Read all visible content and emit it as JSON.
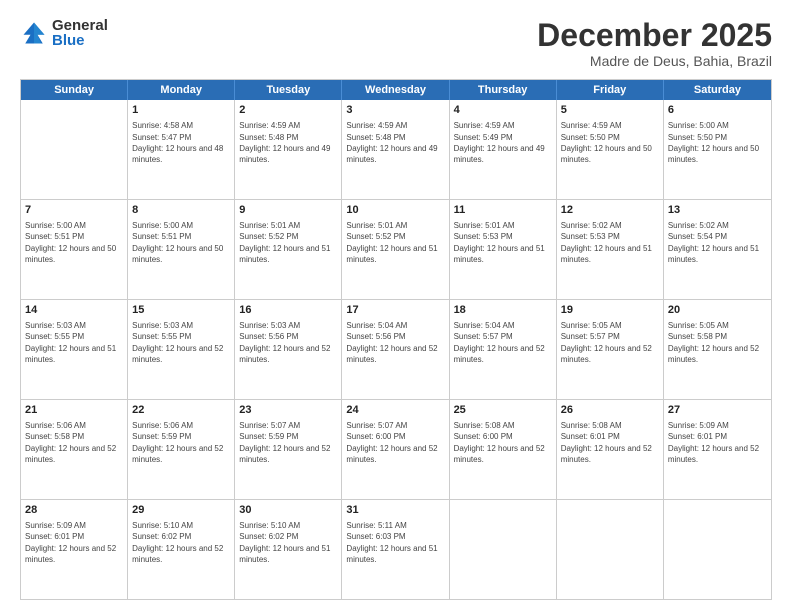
{
  "logo": {
    "general": "General",
    "blue": "Blue"
  },
  "header": {
    "month": "December 2025",
    "location": "Madre de Deus, Bahia, Brazil"
  },
  "weekdays": [
    "Sunday",
    "Monday",
    "Tuesday",
    "Wednesday",
    "Thursday",
    "Friday",
    "Saturday"
  ],
  "weeks": [
    [
      {
        "day": "",
        "sunrise": "",
        "sunset": "",
        "daylight": ""
      },
      {
        "day": "1",
        "sunrise": "Sunrise: 4:58 AM",
        "sunset": "Sunset: 5:47 PM",
        "daylight": "Daylight: 12 hours and 48 minutes."
      },
      {
        "day": "2",
        "sunrise": "Sunrise: 4:59 AM",
        "sunset": "Sunset: 5:48 PM",
        "daylight": "Daylight: 12 hours and 49 minutes."
      },
      {
        "day": "3",
        "sunrise": "Sunrise: 4:59 AM",
        "sunset": "Sunset: 5:48 PM",
        "daylight": "Daylight: 12 hours and 49 minutes."
      },
      {
        "day": "4",
        "sunrise": "Sunrise: 4:59 AM",
        "sunset": "Sunset: 5:49 PM",
        "daylight": "Daylight: 12 hours and 49 minutes."
      },
      {
        "day": "5",
        "sunrise": "Sunrise: 4:59 AM",
        "sunset": "Sunset: 5:50 PM",
        "daylight": "Daylight: 12 hours and 50 minutes."
      },
      {
        "day": "6",
        "sunrise": "Sunrise: 5:00 AM",
        "sunset": "Sunset: 5:50 PM",
        "daylight": "Daylight: 12 hours and 50 minutes."
      }
    ],
    [
      {
        "day": "7",
        "sunrise": "Sunrise: 5:00 AM",
        "sunset": "Sunset: 5:51 PM",
        "daylight": "Daylight: 12 hours and 50 minutes."
      },
      {
        "day": "8",
        "sunrise": "Sunrise: 5:00 AM",
        "sunset": "Sunset: 5:51 PM",
        "daylight": "Daylight: 12 hours and 50 minutes."
      },
      {
        "day": "9",
        "sunrise": "Sunrise: 5:01 AM",
        "sunset": "Sunset: 5:52 PM",
        "daylight": "Daylight: 12 hours and 51 minutes."
      },
      {
        "day": "10",
        "sunrise": "Sunrise: 5:01 AM",
        "sunset": "Sunset: 5:52 PM",
        "daylight": "Daylight: 12 hours and 51 minutes."
      },
      {
        "day": "11",
        "sunrise": "Sunrise: 5:01 AM",
        "sunset": "Sunset: 5:53 PM",
        "daylight": "Daylight: 12 hours and 51 minutes."
      },
      {
        "day": "12",
        "sunrise": "Sunrise: 5:02 AM",
        "sunset": "Sunset: 5:53 PM",
        "daylight": "Daylight: 12 hours and 51 minutes."
      },
      {
        "day": "13",
        "sunrise": "Sunrise: 5:02 AM",
        "sunset": "Sunset: 5:54 PM",
        "daylight": "Daylight: 12 hours and 51 minutes."
      }
    ],
    [
      {
        "day": "14",
        "sunrise": "Sunrise: 5:03 AM",
        "sunset": "Sunset: 5:55 PM",
        "daylight": "Daylight: 12 hours and 51 minutes."
      },
      {
        "day": "15",
        "sunrise": "Sunrise: 5:03 AM",
        "sunset": "Sunset: 5:55 PM",
        "daylight": "Daylight: 12 hours and 52 minutes."
      },
      {
        "day": "16",
        "sunrise": "Sunrise: 5:03 AM",
        "sunset": "Sunset: 5:56 PM",
        "daylight": "Daylight: 12 hours and 52 minutes."
      },
      {
        "day": "17",
        "sunrise": "Sunrise: 5:04 AM",
        "sunset": "Sunset: 5:56 PM",
        "daylight": "Daylight: 12 hours and 52 minutes."
      },
      {
        "day": "18",
        "sunrise": "Sunrise: 5:04 AM",
        "sunset": "Sunset: 5:57 PM",
        "daylight": "Daylight: 12 hours and 52 minutes."
      },
      {
        "day": "19",
        "sunrise": "Sunrise: 5:05 AM",
        "sunset": "Sunset: 5:57 PM",
        "daylight": "Daylight: 12 hours and 52 minutes."
      },
      {
        "day": "20",
        "sunrise": "Sunrise: 5:05 AM",
        "sunset": "Sunset: 5:58 PM",
        "daylight": "Daylight: 12 hours and 52 minutes."
      }
    ],
    [
      {
        "day": "21",
        "sunrise": "Sunrise: 5:06 AM",
        "sunset": "Sunset: 5:58 PM",
        "daylight": "Daylight: 12 hours and 52 minutes."
      },
      {
        "day": "22",
        "sunrise": "Sunrise: 5:06 AM",
        "sunset": "Sunset: 5:59 PM",
        "daylight": "Daylight: 12 hours and 52 minutes."
      },
      {
        "day": "23",
        "sunrise": "Sunrise: 5:07 AM",
        "sunset": "Sunset: 5:59 PM",
        "daylight": "Daylight: 12 hours and 52 minutes."
      },
      {
        "day": "24",
        "sunrise": "Sunrise: 5:07 AM",
        "sunset": "Sunset: 6:00 PM",
        "daylight": "Daylight: 12 hours and 52 minutes."
      },
      {
        "day": "25",
        "sunrise": "Sunrise: 5:08 AM",
        "sunset": "Sunset: 6:00 PM",
        "daylight": "Daylight: 12 hours and 52 minutes."
      },
      {
        "day": "26",
        "sunrise": "Sunrise: 5:08 AM",
        "sunset": "Sunset: 6:01 PM",
        "daylight": "Daylight: 12 hours and 52 minutes."
      },
      {
        "day": "27",
        "sunrise": "Sunrise: 5:09 AM",
        "sunset": "Sunset: 6:01 PM",
        "daylight": "Daylight: 12 hours and 52 minutes."
      }
    ],
    [
      {
        "day": "28",
        "sunrise": "Sunrise: 5:09 AM",
        "sunset": "Sunset: 6:01 PM",
        "daylight": "Daylight: 12 hours and 52 minutes."
      },
      {
        "day": "29",
        "sunrise": "Sunrise: 5:10 AM",
        "sunset": "Sunset: 6:02 PM",
        "daylight": "Daylight: 12 hours and 52 minutes."
      },
      {
        "day": "30",
        "sunrise": "Sunrise: 5:10 AM",
        "sunset": "Sunset: 6:02 PM",
        "daylight": "Daylight: 12 hours and 51 minutes."
      },
      {
        "day": "31",
        "sunrise": "Sunrise: 5:11 AM",
        "sunset": "Sunset: 6:03 PM",
        "daylight": "Daylight: 12 hours and 51 minutes."
      },
      {
        "day": "",
        "sunrise": "",
        "sunset": "",
        "daylight": ""
      },
      {
        "day": "",
        "sunrise": "",
        "sunset": "",
        "daylight": ""
      },
      {
        "day": "",
        "sunrise": "",
        "sunset": "",
        "daylight": ""
      }
    ]
  ]
}
